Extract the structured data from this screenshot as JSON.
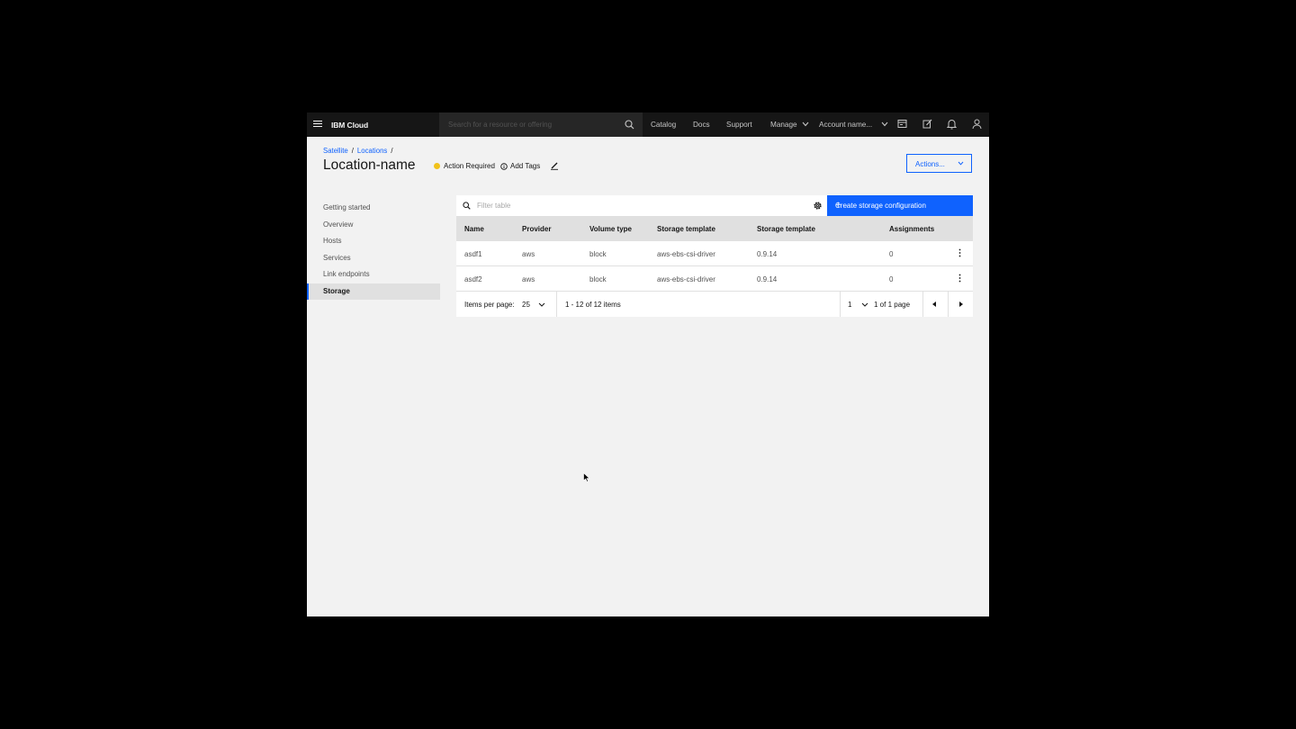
{
  "header": {
    "brand": "IBM Cloud",
    "search_placeholder": "Search for a resource or offering",
    "nav": [
      "Catalog",
      "Docs",
      "Support",
      "Manage",
      "Account name..."
    ]
  },
  "breadcrumb": [
    "Satellite",
    "Locations"
  ],
  "page": {
    "title": "Location-name",
    "status": "Action Required",
    "add_tags": "Add Tags",
    "actions_label": "Actions..."
  },
  "sidebar": {
    "items": [
      "Getting started",
      "Overview",
      "Hosts",
      "Services",
      "Link endpoints",
      "Storage"
    ],
    "active": "Storage"
  },
  "table": {
    "filter_placeholder": "Filter table",
    "create_label": "Create storage configuration",
    "columns": [
      "Name",
      "Provider",
      "Volume type",
      "Storage template",
      "Storage template",
      "Assignments"
    ],
    "rows": [
      [
        "asdf1",
        "aws",
        "block",
        "aws-ebs-csi-driver",
        "0.9.14",
        "0"
      ],
      [
        "asdf2",
        "aws",
        "block",
        "aws-ebs-csi-driver",
        "0.9.14",
        "0"
      ]
    ]
  },
  "pagination": {
    "items_per_page_label": "Items per page:",
    "items_per_page": "25",
    "range": "1 - 12 of 12 items",
    "page": "1",
    "page_of": "1 of 1 page"
  },
  "colors": {
    "accent": "#0f62fe",
    "header_bg": "#161616",
    "status_yellow": "#f1c21b"
  }
}
